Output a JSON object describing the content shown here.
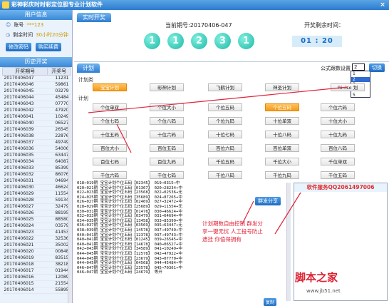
{
  "titlebar": {
    "title": "彩神彩庆时时彩定位胆专业计划软件",
    "close": "×"
  },
  "user": {
    "head": "用户信息",
    "rows": [
      {
        "label": "账号",
        "value": "***123"
      },
      {
        "label": "剩余时间",
        "value": "30小时20分钟"
      }
    ],
    "buttons": [
      "修改密码",
      "购买续费"
    ]
  },
  "history": {
    "head": "历史开奖",
    "columns": [
      "开奖期号",
      "开奖号"
    ],
    "rows": [
      [
        "20170406047",
        "11231"
      ],
      [
        "20170406046",
        "59861"
      ],
      [
        "20170406045",
        "03279"
      ],
      [
        "20170406044",
        "45484"
      ],
      [
        "20170406043",
        "07770"
      ],
      [
        "20170406042",
        "47920"
      ],
      [
        "20170406041",
        "10249"
      ],
      [
        "20170406040",
        "06527"
      ],
      [
        "20170406039",
        "26545"
      ],
      [
        "20170406038",
        "22876"
      ],
      [
        "20170406037",
        "49749"
      ],
      [
        "20170406036",
        "54006"
      ],
      [
        "20170406035",
        "63447"
      ],
      [
        "20170406034",
        "64087"
      ],
      [
        "20170406033",
        "85399"
      ],
      [
        "20170406032",
        "86076"
      ],
      [
        "20170406031",
        "04694"
      ],
      [
        "20170406030",
        "46624"
      ],
      [
        "20170406029",
        "11554"
      ],
      [
        "20170406028",
        "59134"
      ],
      [
        "20170406027",
        "32479"
      ],
      [
        "20170406026",
        "88195"
      ],
      [
        "20170406025",
        "88580"
      ],
      [
        "20170406024",
        "03579"
      ],
      [
        "20170406023",
        "41453"
      ],
      [
        "20170406022",
        "32536"
      ],
      [
        "20170406021",
        "35002"
      ],
      [
        "20170406020",
        "00848"
      ],
      [
        "20170406019",
        "83515"
      ],
      [
        "20170406018",
        "38218"
      ],
      [
        "20170406017",
        "01944"
      ],
      [
        "20170406016",
        "12089"
      ],
      [
        "20170406015",
        "21554"
      ],
      [
        "20170406014",
        "55895"
      ]
    ]
  },
  "draw": {
    "tab": "实时开奖",
    "issue": "当前期号:20170406-047",
    "balls": [
      "1",
      "1",
      "2",
      "3",
      "1"
    ],
    "countdown_label": "开奖剩余时间：",
    "countdown": "01 : 20"
  },
  "plan": {
    "tab": "计划",
    "formula_label": "公式跟数设置",
    "formula_value": "2",
    "formula_options": [
      "1",
      "2",
      "3",
      "4",
      "5"
    ],
    "switch": "切换",
    "plan_type_label": "计划类",
    "plan_types": [
      "宝宝计划",
      "彩神计划",
      "飞鹤计划",
      "神圣计划",
      "Ri..iso 划"
    ],
    "plan_label": "计划",
    "cells": [
      [
        "个位单双",
        "个位大小",
        "个位五码",
        "个位五码",
        "个位六码"
      ],
      [
        "个位七码",
        "个位八码",
        "个位九码",
        "十位单双",
        "十位大小"
      ],
      [
        "十位五码",
        "十位六码",
        "十位七码",
        "十位八码",
        "十位九码"
      ],
      [
        "百位大小",
        "百位五码",
        "百位六码",
        "百位单双",
        "百位八码"
      ],
      [
        "百位七码",
        "百位九码",
        "千位五码",
        "千位大小",
        "千位单双"
      ],
      [
        "千位六码",
        "千位七码",
        "千位八码",
        "千位九码",
        "千位五码"
      ]
    ]
  },
  "bottom": {
    "results": [
      "018→019期 宝宝计划个位五码【02345】 019→0315→中",
      "020→021期 宝宝计划个位五码【01367】 020→28234→中",
      "022→023期 宝宝计划个位五码【23568】 022→02536→无",
      "024→025期 宝宝计划个位五码【35689】 024→87265→中",
      "026→027期 宝宝计划个位五码【02469】 027→32472→中",
      "028→029期 宝宝计划个位五码【25689】 029→11554→无",
      "030→031期 宝宝计划个位五码【01478】 030→46624→中",
      "032→033期 宝宝计划个位五码【03479】 031→64694→中",
      "034→035期 宝宝计划个位五码【13458】 033→85399→中",
      "036→037期 宝宝计划个位五码【03569】 035→63447→无",
      "038→039期 宝宝计划个位五码【14578】 037→49749→中",
      "040→041期 宝宝计划个位五码【12378】 037→49743→中",
      "040→041期 宝宝计划个位五码【01245】 039→26545→中",
      "040→041期 宝宝计划个位五码【14678】 040→06527→中",
      "042→043期 宝宝计划个位五码【34589】 041→10249→中",
      "044→045期 宝宝计划个位五码【12578】 042→47922→中",
      "044→045期 宝宝计划个位五码【23679】 043→07770→中",
      "044→045期 宝宝计划个位五码【04568】 044→45484→中",
      "046→047期 宝宝计划个位五码【23578】 045→70361→中",
      "046→047期 宝宝计划个位五码【24679】 等开"
    ],
    "share": "群发分享",
    "copy": "复制",
    "annotation": "计划期数自由控制 群发分享一键无忧 人工投号防止遗挂 你值得拥有",
    "qq": "软件服务QQ2061497006"
  },
  "watermark": {
    "text": "脚本之家",
    "url": "www.jb51.net"
  },
  "colors": {
    "accent": "#2f7ed2",
    "ball": "#1fb8a6",
    "active": "#f59a16",
    "annotation": "#e0243a"
  }
}
